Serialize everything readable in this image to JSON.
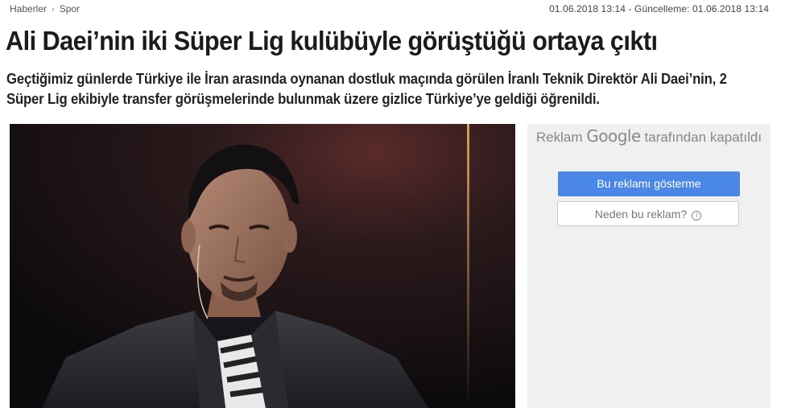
{
  "breadcrumb": {
    "items": [
      "Haberler",
      "Spor"
    ],
    "separator": "›"
  },
  "dates": {
    "published": "01.06.2018  13:14",
    "updated_label": "- Güncelleme:",
    "updated": "01.06.2018  13:14"
  },
  "article": {
    "title": "Ali Daei’nin iki Süper Lig kulübüyle görüştüğü ortaya çıktı",
    "summary": "Geçtiğimiz günlerde Türkiye ile İran arasında oynanan dostluk maçında görülen İranlı Teknik Direktör Ali Daei’nin, 2 Süper Lig ekibiyle transfer görüşmelerinde bulunmak üzere gizlice Türkiye’ye geldiği öğrenildi.",
    "photo_icon": "portrait-photo"
  },
  "ad": {
    "header_prefix": "Reklam",
    "header_brand": "Google",
    "header_suffix": "tarafından kapatıldı",
    "primary_button": "Bu reklamı gösterme",
    "secondary_button": "Neden bu reklam?",
    "info_glyph": "i",
    "colors": {
      "primary": "#4b87e6",
      "background": "#f0f0f0"
    }
  }
}
